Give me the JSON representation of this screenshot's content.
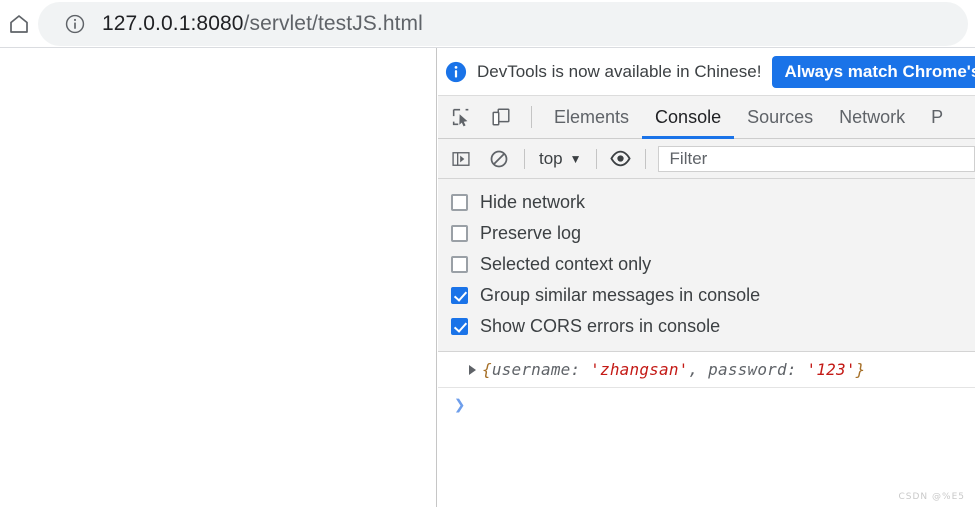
{
  "browser": {
    "home_icon": "home-icon",
    "omnibox": {
      "info_icon": "site-info-icon",
      "url_host": "127.0.0.1:8080",
      "url_path": "/servlet/testJS.html"
    }
  },
  "devtools": {
    "infobar": {
      "icon": "info-circle-icon",
      "message": "DevTools is now available in Chinese!",
      "primary_button": "Always match Chrome's"
    },
    "toolbar": {
      "inspect_icon": "inspect-element-icon",
      "device_icon": "device-toolbar-icon",
      "tabs": [
        {
          "label": "Elements",
          "active": false
        },
        {
          "label": "Console",
          "active": true
        },
        {
          "label": "Sources",
          "active": false
        },
        {
          "label": "Network",
          "active": false
        },
        {
          "label": "P",
          "active": false
        }
      ]
    },
    "console_toolbar": {
      "sidebar_icon": "console-sidebar-icon",
      "clear_icon": "clear-console-icon",
      "context_label": "top",
      "context_caret": "▼",
      "eye_icon": "live-expression-eye-icon",
      "filter_placeholder": "Filter",
      "filter_value": ""
    },
    "settings": [
      {
        "label": "Hide network",
        "checked": false
      },
      {
        "label": "Preserve log",
        "checked": false
      },
      {
        "label": "Selected context only",
        "checked": false
      },
      {
        "label": "Group similar messages in console",
        "checked": true
      },
      {
        "label": "Show CORS errors in console",
        "checked": true
      }
    ],
    "console_output": {
      "disclosure_icon": "expand-triangle-icon",
      "object": {
        "open_brace": "{",
        "key1": "username: ",
        "value1": "'zhangsan'",
        "comma": ", ",
        "key2": "password: ",
        "value2": "'123'",
        "close_brace": "}"
      }
    },
    "prompt": {
      "arrow": "❯",
      "input_value": ""
    },
    "colors": {
      "accent_blue": "#1a73e8",
      "string_red": "#c41a16",
      "brace_orange": "#a6712a",
      "toolbar_grey": "#f3f3f3"
    }
  },
  "watermark": "CSDN @%E5"
}
